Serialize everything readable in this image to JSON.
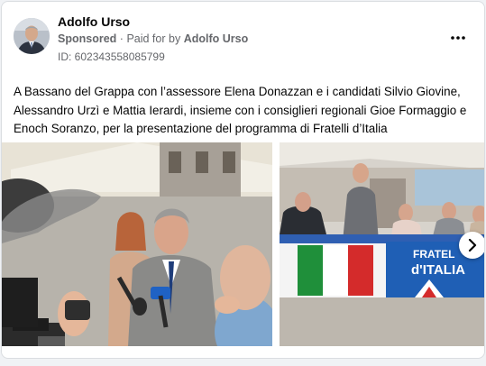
{
  "post": {
    "page_name": "Adolfo Urso",
    "sponsored_label": "Sponsored",
    "separator": "·",
    "paid_for_prefix": "Paid for by",
    "paid_for_name": "Adolfo Urso",
    "ad_id": "ID: 602343558085799",
    "text": "A Bassano del Grappa con l’assessore Elena Donazzan e i candidati Silvio Giovine, Alessandro Urzì e Mattia Ierardi, insieme con i consiglieri regionali Gioe Formaggio e Enoch Soranzo, per la presentazione del programma di Fratelli d’Italia"
  },
  "icons": {
    "more": "more-horizontal-icon",
    "next": "chevron-right-icon"
  },
  "carousel": {
    "slide2_banner_line1": "FRATEL",
    "slide2_banner_line2": "d'ITALIA"
  },
  "colors": {
    "text_primary": "#050505",
    "text_secondary": "#65676b",
    "flag_green": "#1f8f3a",
    "flag_red": "#d42b2b",
    "banner_blue": "#1f5fb5"
  }
}
